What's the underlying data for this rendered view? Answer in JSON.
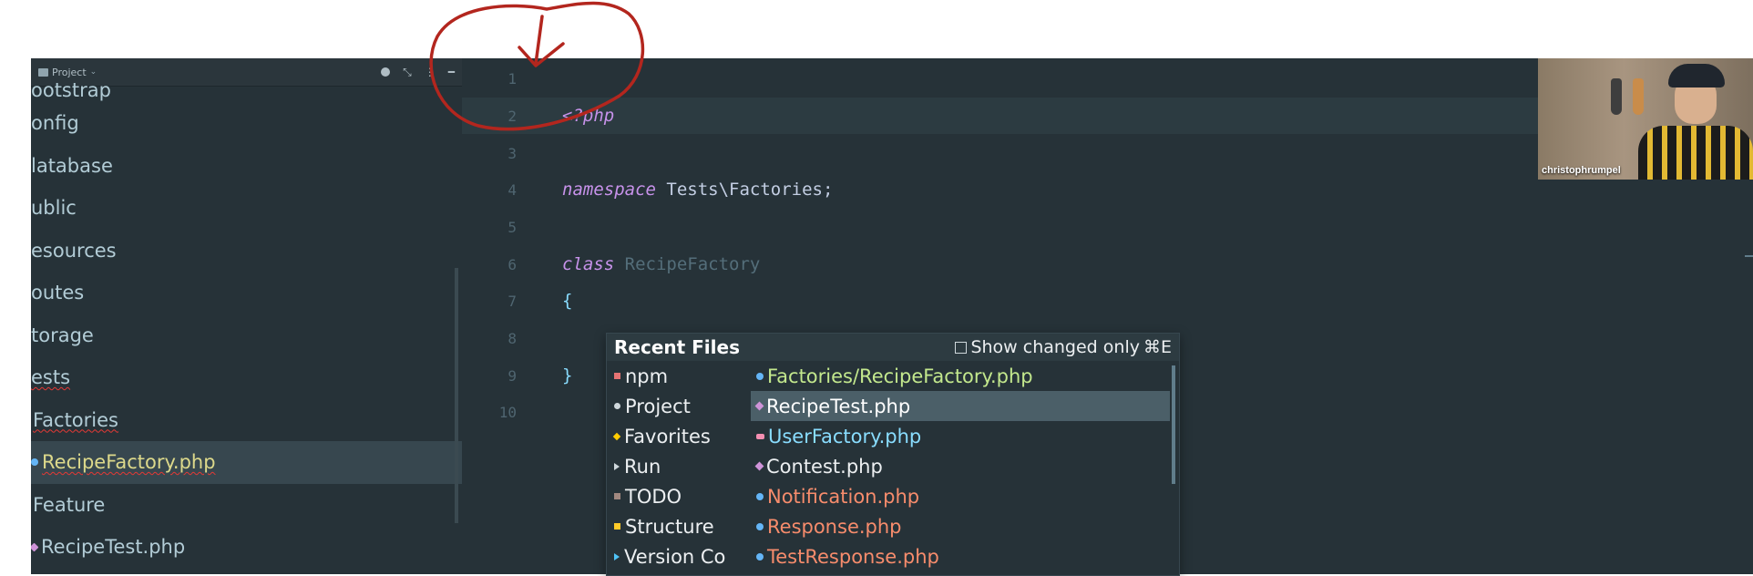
{
  "project_panel": {
    "header": {
      "title": "Project"
    },
    "tree": [
      {
        "label": "ootstrap",
        "kind": "folder"
      },
      {
        "label": "onfig",
        "kind": "folder"
      },
      {
        "label": "latabase",
        "kind": "folder"
      },
      {
        "label": "ublic",
        "kind": "folder"
      },
      {
        "label": "esources",
        "kind": "folder"
      },
      {
        "label": "outes",
        "kind": "folder"
      },
      {
        "label": "torage",
        "kind": "folder"
      },
      {
        "label": "ests",
        "kind": "folder"
      },
      {
        "label": "Factories",
        "kind": "folder"
      },
      {
        "label": "RecipeFactory.php",
        "kind": "file"
      },
      {
        "label": "Feature",
        "kind": "folder"
      },
      {
        "label": "RecipeTest.php",
        "kind": "file"
      }
    ]
  },
  "editor": {
    "line_numbers": [
      "1",
      "2",
      "3",
      "4",
      "5",
      "6",
      "7",
      "8",
      "9",
      "10"
    ],
    "code": {
      "line2": "<?php",
      "line4_kw": "namespace",
      "line4_rest": " Tests\\Factories;",
      "line6_kw": "class",
      "line6_rest": " RecipeFactory",
      "line7": "{",
      "line9": "}"
    }
  },
  "recent_files": {
    "title": "Recent Files",
    "show_changed_label": "Show changed only",
    "shortcut": "⌘E",
    "tool_windows": [
      "npm",
      "Project",
      "Favorites",
      "Run",
      "TODO",
      "Structure",
      "Version Co"
    ],
    "files": [
      {
        "label": "Factories/RecipeFactory.php",
        "color": "#c3e88d"
      },
      {
        "label": "RecipeTest.php",
        "color": "#ffffff"
      },
      {
        "label": "UserFactory.php",
        "color": "#89ddff"
      },
      {
        "label": "Contest.php",
        "color": "#eceff1"
      },
      {
        "label": "Notification.php",
        "color": "#f78c6c"
      },
      {
        "label": "Response.php",
        "color": "#f78c6c"
      },
      {
        "label": "TestResponse.php",
        "color": "#f78c6c"
      }
    ],
    "selected_index": 1
  },
  "webcam": {
    "name": "christophrumpel"
  },
  "colors": {
    "background": "#263238",
    "accent": "#c792ea",
    "annotation": "#b3261e"
  }
}
